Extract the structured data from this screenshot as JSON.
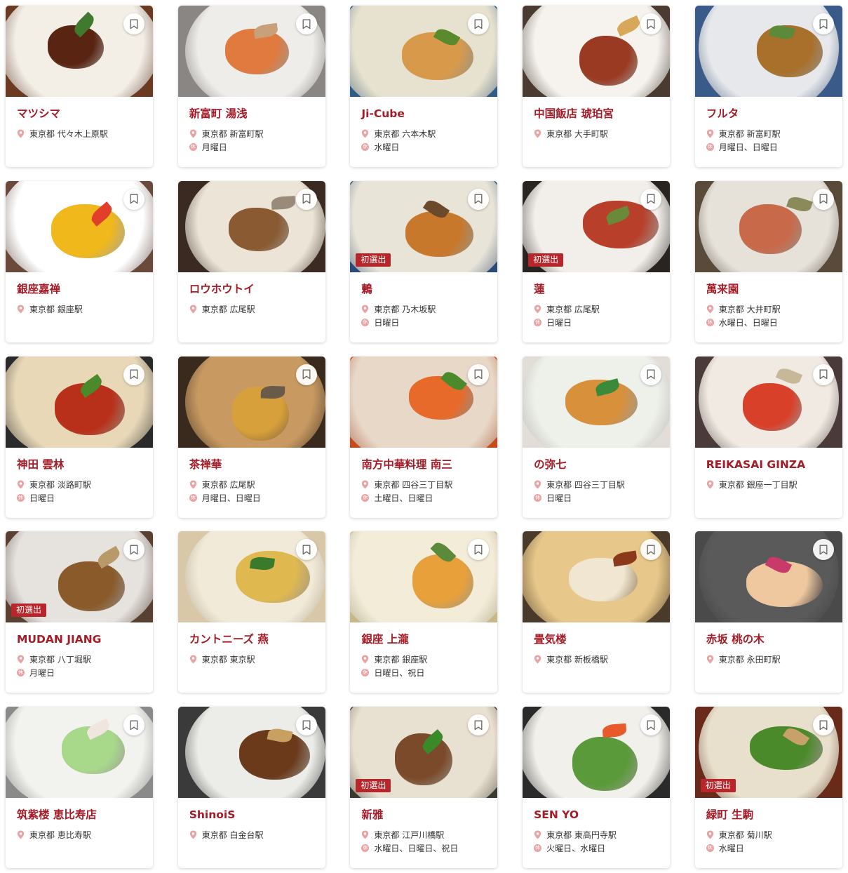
{
  "ui": {
    "accent": "#a41c27",
    "badge_color": "#b8252b",
    "bookmark_icon": "bookmark-outline-icon",
    "location_icon": "map-pin-icon",
    "holiday_icon": "holiday-icon",
    "holiday_glyph": "休"
  },
  "restaurants": [
    {
      "name": "マツシマ",
      "location": "東京都 代々木上原駅",
      "holiday": "",
      "badge": "",
      "photo": {
        "bg": "#6b3a22",
        "plate": "#f3efe7",
        "food": "#5a2412",
        "garnish": "#3f7a2e"
      }
    },
    {
      "name": "新富町 湯浅",
      "location": "東京都 新富町駅",
      "holiday": "月曜日",
      "badge": "",
      "photo": {
        "bg": "#8a8683",
        "plate": "#efede9",
        "food": "#e07a3e",
        "garnish": "#c8a07a"
      }
    },
    {
      "name": "Ji-Cube",
      "location": "東京都 六本木駅",
      "holiday": "水曜日",
      "badge": "",
      "photo": {
        "bg": "#2d5c8a",
        "plate": "#e7e2cf",
        "food": "#d89a4a",
        "garnish": "#5a8a2e"
      }
    },
    {
      "name": "中国飯店 琥珀宮",
      "location": "東京都 大手町駅",
      "holiday": "",
      "badge": "",
      "photo": {
        "bg": "#4a3a30",
        "plate": "#f6f3ee",
        "food": "#9a3a22",
        "garnish": "#d8a85a"
      }
    },
    {
      "name": "フルタ",
      "location": "東京都 新富町駅",
      "holiday": "月曜日、日曜日",
      "badge": "",
      "photo": {
        "bg": "#3a5a8a",
        "plate": "#e6e8ec",
        "food": "#a8702a",
        "garnish": "#5a8a3a"
      }
    },
    {
      "name": "銀座嘉禅",
      "location": "東京都 銀座駅",
      "holiday": "",
      "badge": "",
      "photo": {
        "bg": "#6a4a3a",
        "plate": "#ffffff",
        "food": "#f0b81a",
        "garnish": "#e0402a"
      }
    },
    {
      "name": "ロウホウトイ",
      "location": "東京都 広尾駅",
      "holiday": "",
      "badge": "",
      "photo": {
        "bg": "#3a2a22",
        "plate": "#ece4d6",
        "food": "#8a5a32",
        "garnish": "#9a8a7a"
      }
    },
    {
      "name": "鶫",
      "location": "東京都 乃木坂駅",
      "holiday": "日曜日",
      "badge": "初選出",
      "photo": {
        "bg": "#2a4a7a",
        "plate": "#e8e4d8",
        "food": "#c8782a",
        "garnish": "#6a4a2a"
      }
    },
    {
      "name": "蓮",
      "location": "東京都 広尾駅",
      "holiday": "日曜日",
      "badge": "初選出",
      "photo": {
        "bg": "#2a2420",
        "plate": "#f2efea",
        "food": "#b8402a",
        "garnish": "#6a8a3a"
      }
    },
    {
      "name": "萬来園",
      "location": "東京都 大井町駅",
      "holiday": "水曜日、日曜日",
      "badge": "",
      "photo": {
        "bg": "#5a4a3a",
        "plate": "#e6e2da",
        "food": "#c86a4a",
        "garnish": "#8a8a5a"
      }
    },
    {
      "name": "神田 雲林",
      "location": "東京都 淡路町駅",
      "holiday": "日曜日",
      "badge": "",
      "photo": {
        "bg": "#2a2a2a",
        "plate": "#e8d8b8",
        "food": "#b8301a",
        "garnish": "#4a8a2a"
      }
    },
    {
      "name": "茶禅華",
      "location": "東京都 広尾駅",
      "holiday": "月曜日、日曜日",
      "badge": "",
      "photo": {
        "bg": "#3a2a1e",
        "plate": "#c89a62",
        "food": "#d8a03a",
        "garnish": "#6a5a4a"
      }
    },
    {
      "name": "南方中華料理 南三",
      "location": "東京都 四谷三丁目駅",
      "holiday": "土曜日、日曜日",
      "badge": "",
      "photo": {
        "bg": "#c84a1a",
        "plate": "#e8d8c8",
        "food": "#e86a2a",
        "garnish": "#4a8a2a"
      }
    },
    {
      "name": "の弥七",
      "location": "東京都 四谷三丁目駅",
      "holiday": "日曜日",
      "badge": "",
      "photo": {
        "bg": "#e2ddd6",
        "plate": "#eef0ea",
        "food": "#d8903a",
        "garnish": "#3a8a3a"
      }
    },
    {
      "name": "REIKASAI GINZA",
      "location": "東京都 銀座一丁目駅",
      "holiday": "",
      "badge": "",
      "photo": {
        "bg": "#4a3a3a",
        "plate": "#f0eae2",
        "food": "#d8402a",
        "garnish": "#c8b89a"
      }
    },
    {
      "name": "MUDAN JIANG",
      "location": "東京都 八丁堀駅",
      "holiday": "月曜日",
      "badge": "初選出",
      "photo": {
        "bg": "#5a4030",
        "plate": "#e6e2de",
        "food": "#8a5a2a",
        "garnish": "#b89a6a"
      }
    },
    {
      "name": "カントニーズ 燕",
      "location": "東京都 東京駅",
      "holiday": "",
      "badge": "",
      "photo": {
        "bg": "#d8c8a8",
        "plate": "#f2ead8",
        "food": "#e0b850",
        "garnish": "#3a7a2a"
      }
    },
    {
      "name": "銀座 上瀧",
      "location": "東京都 銀座駅",
      "holiday": "日曜日、祝日",
      "badge": "",
      "photo": {
        "bg": "#c8b888",
        "plate": "#f2ecd8",
        "food": "#e8a03a",
        "garnish": "#5a8a3a"
      }
    },
    {
      "name": "畳気楼",
      "location": "東京都 新板橋駅",
      "holiday": "",
      "badge": "",
      "photo": {
        "bg": "#4a3a2a",
        "plate": "#e8c88a",
        "food": "#f0e6d2",
        "garnish": "#8a3a1a"
      }
    },
    {
      "name": "赤坂 桃の木",
      "location": "東京都 永田町駅",
      "holiday": "",
      "badge": "",
      "photo": {
        "bg": "#4a4a4a",
        "plate": "#5a5a5a",
        "food": "#f0c8a0",
        "garnish": "#c83a6a"
      }
    },
    {
      "name": "筑紫楼 恵比寿店",
      "location": "東京都 恵比寿駅",
      "holiday": "",
      "badge": "",
      "photo": {
        "bg": "#8a8a8a",
        "plate": "#f2f2ee",
        "food": "#a8d88a",
        "garnish": "#f0e6e0"
      }
    },
    {
      "name": "ShinoiS",
      "location": "東京都 白金台駅",
      "holiday": "",
      "badge": "",
      "photo": {
        "bg": "#3a3a3a",
        "plate": "#ecece8",
        "food": "#6a3a1a",
        "garnish": "#c8a060"
      }
    },
    {
      "name": "新雅",
      "location": "東京都 江戸川橋駅",
      "holiday": "水曜日、日曜日、祝日",
      "badge": "初選出",
      "photo": {
        "bg": "#3a3a30",
        "plate": "#e8e0d0",
        "food": "#7a4a2a",
        "garnish": "#3a8a2a"
      }
    },
    {
      "name": "SEN YO",
      "location": "東京都 東高円寺駅",
      "holiday": "火曜日、水曜日",
      "badge": "",
      "photo": {
        "bg": "#2a2a2a",
        "plate": "#f2f0ea",
        "food": "#5a9a3a",
        "garnish": "#e85a2a"
      }
    },
    {
      "name": "緑町 生駒",
      "location": "東京都 菊川駅",
      "holiday": "水曜日",
      "badge": "初選出",
      "photo": {
        "bg": "#6a2a1a",
        "plate": "#e8e0cc",
        "food": "#4a8a2a",
        "garnish": "#c8a06a"
      }
    }
  ]
}
